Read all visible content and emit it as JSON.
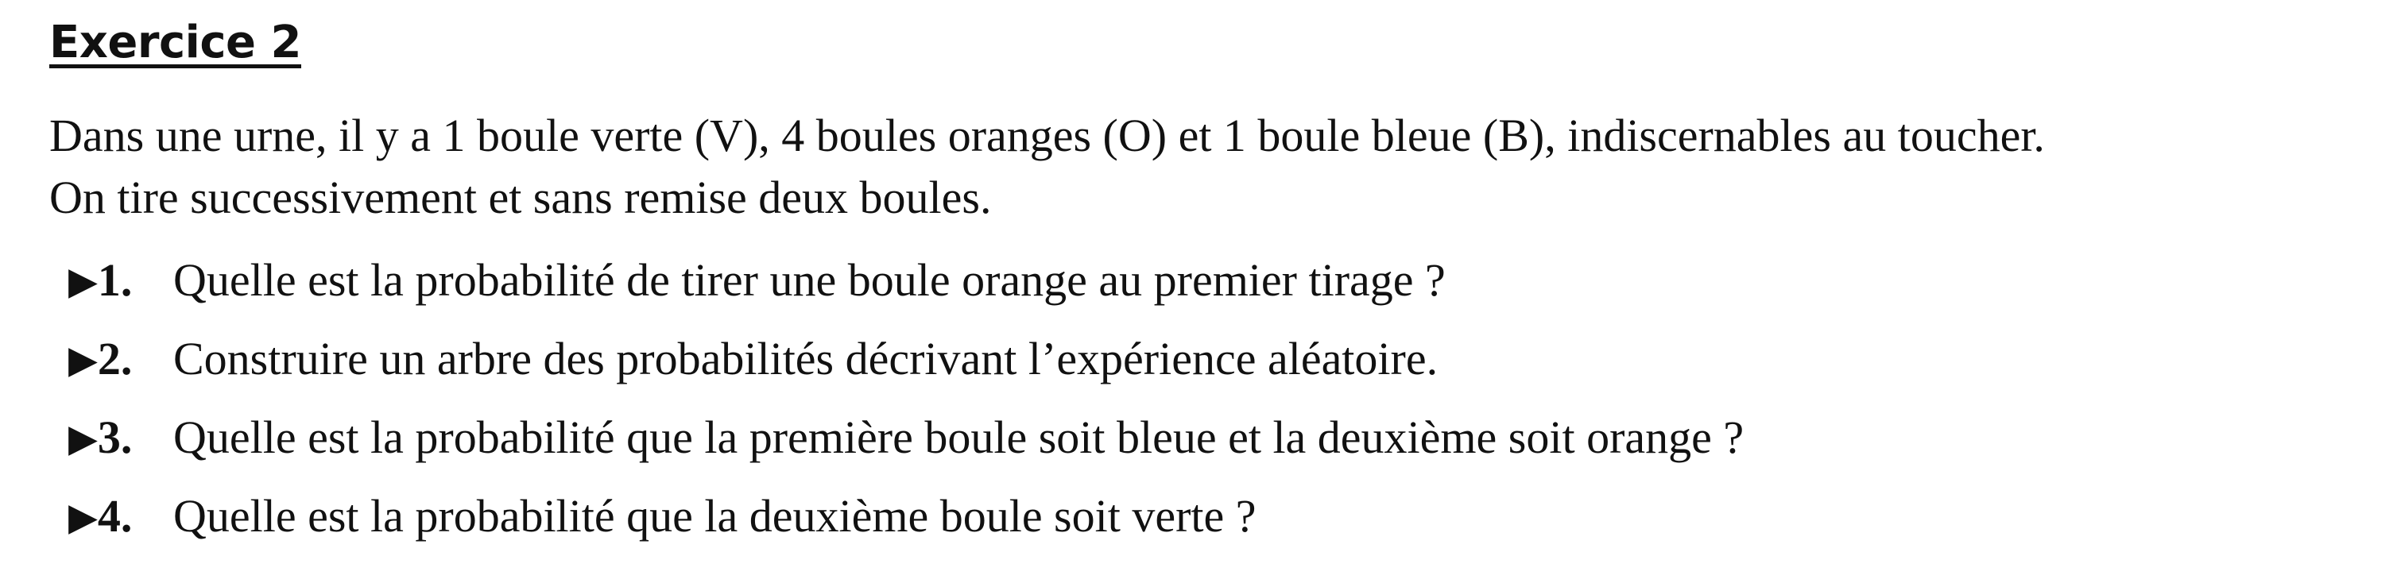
{
  "exercise": {
    "title": "Exercice 2",
    "intro_line1": "Dans une urne, il y a 1 boule verte (V), 4 boules oranges (O) et 1 boule bleue (B), indiscernables au toucher.",
    "intro_line2": "On tire successivement et sans remise deux boules.",
    "arrow_glyph": "▶",
    "questions": [
      {
        "number": "1.",
        "text": "Quelle est la probabilité de tirer une boule orange au premier tirage ?"
      },
      {
        "number": "2.",
        "text": "Construire un arbre des probabilités décrivant l’expérience aléatoire."
      },
      {
        "number": "3.",
        "text": "Quelle est la probabilité que la première boule soit bleue et la deuxième soit orange ?"
      },
      {
        "number": "4.",
        "text": "Quelle est la probabilité que la deuxième boule soit verte ?"
      }
    ]
  }
}
